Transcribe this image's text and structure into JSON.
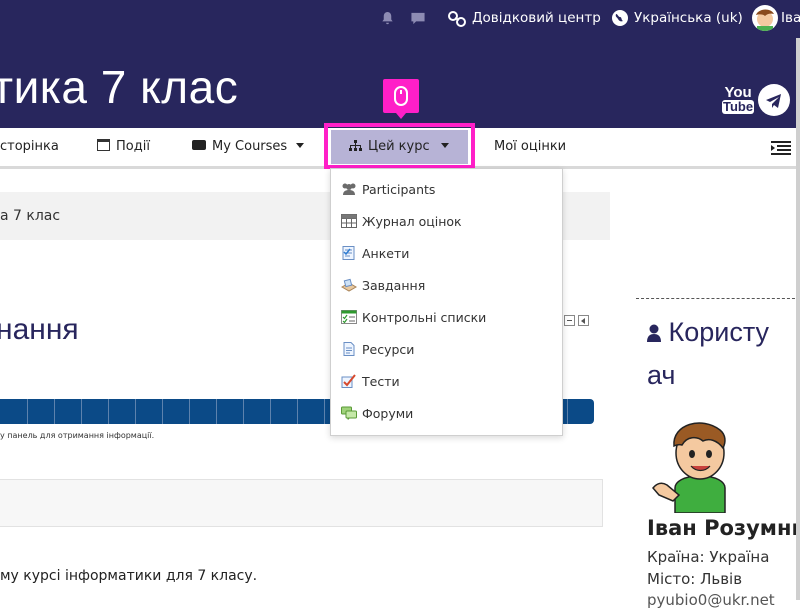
{
  "topbar": {
    "help_label": "Довідковий центр",
    "language_label": "Українська (uk)",
    "user_label_partial": "Іва",
    "icons": [
      "bell-icon",
      "chat-icon",
      "link-icon",
      "globe-icon"
    ]
  },
  "header": {
    "title": "тика 7 клас",
    "social": {
      "youtube_top": "You",
      "youtube_bottom": "Tube"
    }
  },
  "nav": {
    "items": [
      {
        "label": "сторінка"
      },
      {
        "label": "Події"
      },
      {
        "label": "My Courses"
      },
      {
        "label": "Цей курс"
      },
      {
        "label": "Мої оцінки"
      }
    ]
  },
  "breadcrumb": {
    "text": "а 7 клас"
  },
  "dropdown": {
    "items": [
      {
        "label": "Participants",
        "icon": "participants-icon"
      },
      {
        "label": "Журнал оцінок",
        "icon": "gradebook-icon"
      },
      {
        "label": "Анкети",
        "icon": "questionnaire-icon"
      },
      {
        "label": "Завдання",
        "icon": "assignment-icon"
      },
      {
        "label": "Контрольні списки",
        "icon": "checklist-icon"
      },
      {
        "label": "Ресурси",
        "icon": "resource-icon"
      },
      {
        "label": "Тести",
        "icon": "quiz-icon"
      },
      {
        "label": "Форуми",
        "icon": "forum-icon"
      }
    ]
  },
  "main": {
    "section_title": "нання",
    "progress_note": "у панель для отримання інформації.",
    "intro_text": "му курсі інформатики для 7 класу."
  },
  "user_block": {
    "title_line1": "Користу",
    "title_line2": "ач",
    "name": "Іван Розумни",
    "country": "Країна: Україна",
    "city": "Місто: Львів",
    "email_partial": "руubio0@ukr.net"
  },
  "colors": {
    "brand_dark": "#28265d",
    "highlight_magenta": "#ff1fc8",
    "progress_blue": "#0b4a87",
    "active_nav_bg": "#b7b3d6"
  }
}
